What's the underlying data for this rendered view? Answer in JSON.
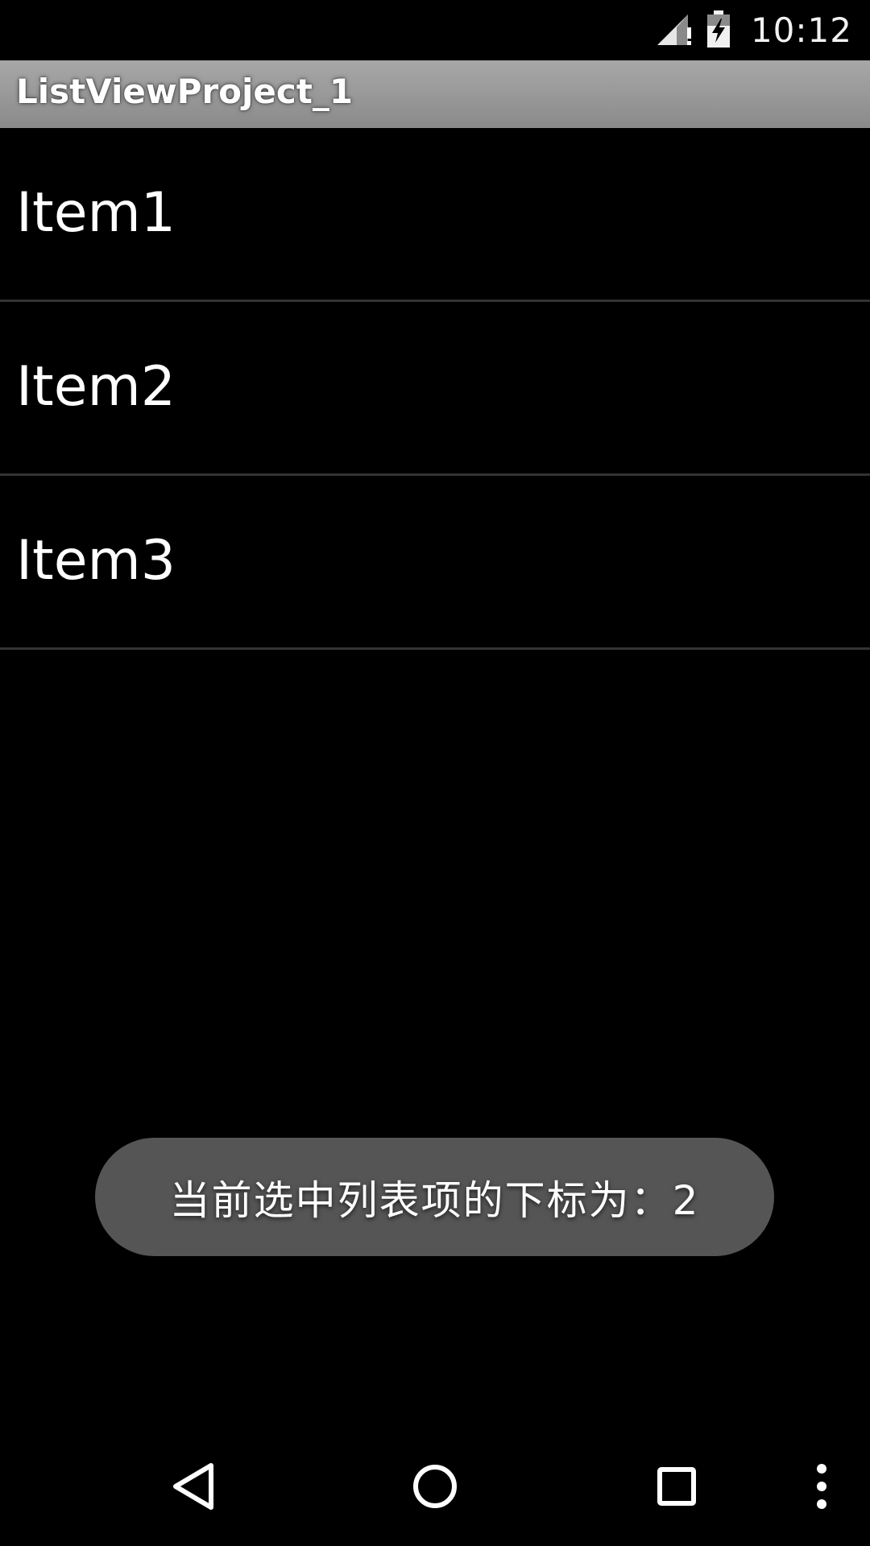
{
  "status_bar": {
    "time": "10:12",
    "icons": [
      "signal-no-data-icon",
      "battery-charging-icon"
    ]
  },
  "action_bar": {
    "title": "ListViewProject_1"
  },
  "list": {
    "items": [
      {
        "label": "Item1"
      },
      {
        "label": "Item2"
      },
      {
        "label": "Item3"
      }
    ]
  },
  "toast": {
    "message": "当前选中列表项的下标为：2"
  },
  "nav_bar": {
    "buttons": [
      "back-icon",
      "home-icon",
      "recents-icon",
      "overflow-menu-icon"
    ]
  },
  "colors": {
    "background": "#000000",
    "action_bar": "#9c9c9c",
    "divider": "#333333",
    "toast_background": "#555555",
    "text": "#ffffff"
  }
}
